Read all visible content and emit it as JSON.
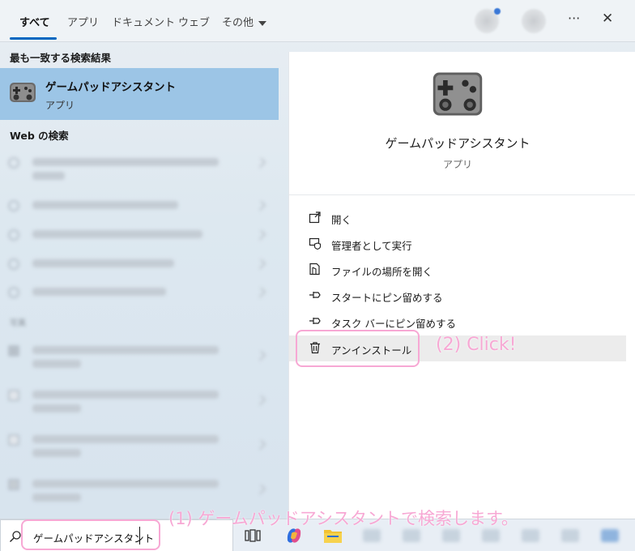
{
  "tabs": [
    {
      "label": "すべて"
    },
    {
      "label": "アプリ"
    },
    {
      "label": "ドキュメント"
    },
    {
      "label": "ウェブ"
    },
    {
      "label": "その他"
    }
  ],
  "window_controls": {
    "more": "···",
    "close": "✕"
  },
  "left": {
    "best_match_title": "最も一致する検索結果",
    "best_match": {
      "name": "ゲームパッドアシスタント",
      "type": "アプリ"
    },
    "web_title": "Web の検索",
    "other_title": "写真"
  },
  "right": {
    "app_name": "ゲームパッドアシスタント",
    "app_type": "アプリ",
    "actions": [
      {
        "label": "開く",
        "icon": "open-icon"
      },
      {
        "label": "管理者として実行",
        "icon": "admin-shield-icon"
      },
      {
        "label": "ファイルの場所を開く",
        "icon": "file-location-icon"
      },
      {
        "label": "スタートにピン留めする",
        "icon": "pin-icon"
      },
      {
        "label": "タスク バーにピン留めする",
        "icon": "pin-icon"
      },
      {
        "label": "アンインストール",
        "icon": "trash-icon"
      }
    ]
  },
  "annotations": {
    "click": "(2) Click!",
    "search_step": "(1) ゲームパッドアシスタントで検索します。"
  },
  "taskbar": {
    "search_value": "ゲームパッドアシスタント"
  },
  "colors": {
    "accent": "#0067c0",
    "highlight": "#9cc5e6",
    "annotation": "#f7a8d4"
  }
}
